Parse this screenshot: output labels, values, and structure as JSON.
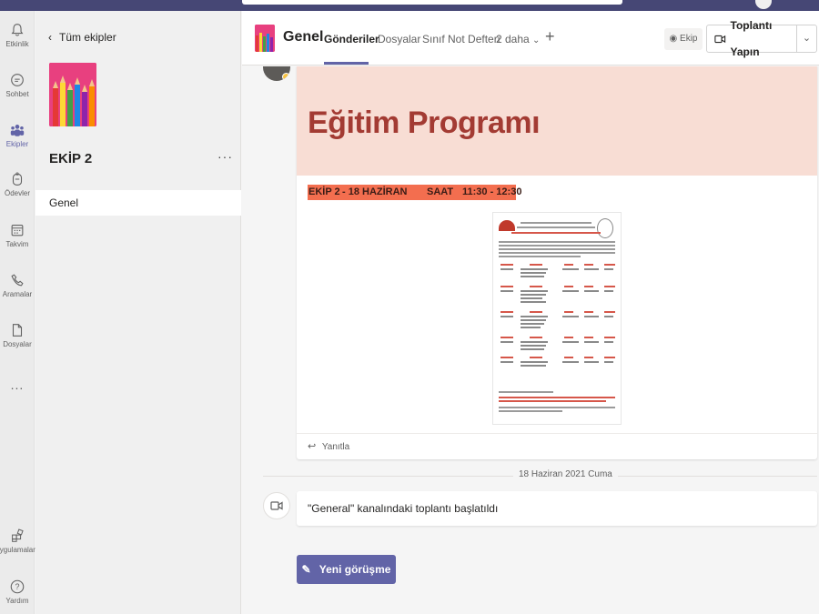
{
  "rail": {
    "items": [
      {
        "label": "Etkinlik",
        "icon": "bell-icon"
      },
      {
        "label": "Sohbet",
        "icon": "chat-icon"
      },
      {
        "label": "Ekipler",
        "icon": "teams-icon",
        "active": true
      },
      {
        "label": "Ödevler",
        "icon": "assignments-icon"
      },
      {
        "label": "Takvim",
        "icon": "calendar-icon"
      },
      {
        "label": "Aramalar",
        "icon": "phone-icon"
      },
      {
        "label": "Dosyalar",
        "icon": "file-icon"
      }
    ],
    "more": "...",
    "apps_label": "Uygulamalar",
    "help_label": "Yardım"
  },
  "team_panel": {
    "back_label": "Tüm ekipler",
    "team_name": "EKİP 2",
    "more": "···",
    "channels": [
      {
        "label": "Genel"
      }
    ]
  },
  "channel_header": {
    "title": "Genel",
    "tabs": [
      {
        "label": "Gönderiler",
        "active": true
      },
      {
        "label": "Dosyalar"
      },
      {
        "label": "Sınıf Not Defteri"
      },
      {
        "label": "2 daha"
      }
    ],
    "add_tab": "+",
    "team_button": "Ekip",
    "meet_button": "Toplantı Yapın",
    "meet_dropdown": "⌄"
  },
  "post": {
    "banner_title": "Eğitim Programı",
    "highlight": {
      "team": "EKİP 2",
      "date": "- 18 HAZİRAN",
      "time_label": "SAAT",
      "time": "11:30 - 12:30"
    },
    "reply_label": "Yanıtla"
  },
  "date_divider": "18 Haziran 2021 Cuma",
  "meeting_message": "\"General\" kanalındaki toplantı başlatıldı",
  "new_conversation_label": "Yeni görüşme",
  "colors": {
    "accent": "#6264a7",
    "header": "#464775",
    "banner_bg": "#f8ddd4",
    "banner_title": "#a33b33",
    "highlight": "#f36e4f"
  }
}
